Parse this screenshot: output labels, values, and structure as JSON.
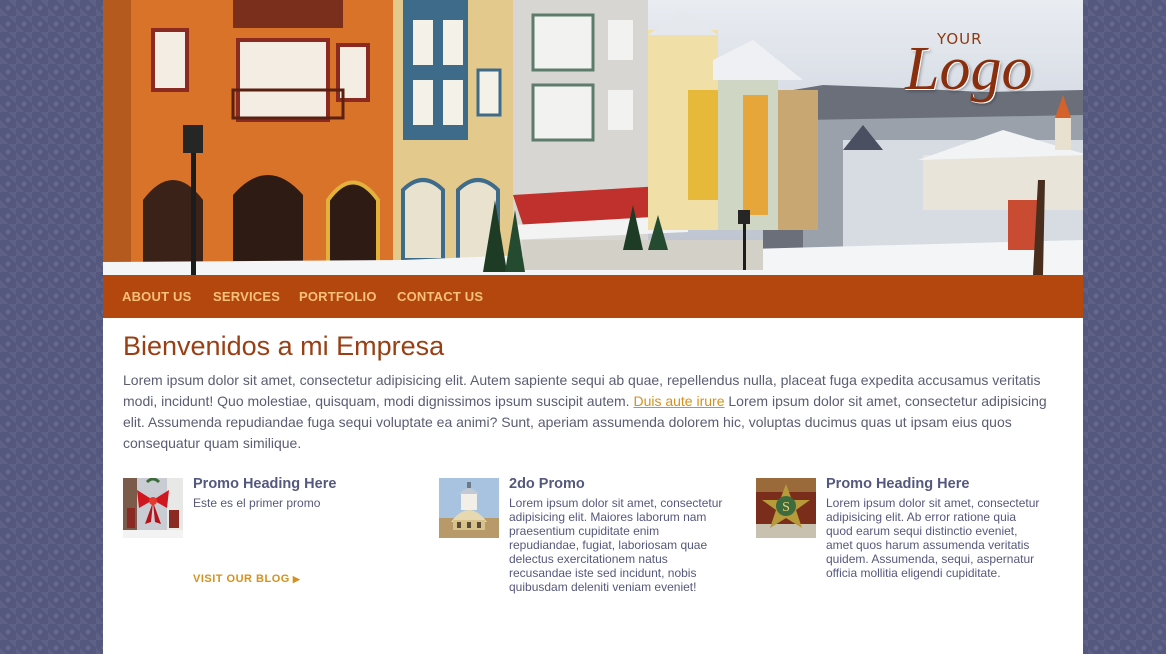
{
  "logo": {
    "small": "YOUR",
    "main": "Logo"
  },
  "nav": {
    "items": [
      {
        "label": "ABOUT US"
      },
      {
        "label": "SERVICES"
      },
      {
        "label": "PORTFOLIO"
      },
      {
        "label": "CONTACT US"
      }
    ]
  },
  "main": {
    "heading": "Bienvenidos a mi Empresa",
    "intro_before": "Lorem ipsum dolor sit amet, consectetur adipisicing elit. Autem sapiente sequi ab quae, repellendus nulla, placeat fuga expedita accusamus veritatis modi, incidunt! Quo molestiae, quisquam, modi dignissimos ipsum suscipit autem.",
    "intro_link": "Duis aute irure",
    "intro_after": "Lorem ipsum dolor sit amet, consectetur adipisicing elit. Assumenda repudiandae fuga sequi voluptate ea animi? Sunt, aperiam assumenda dolorem hic, voluptas ducimus quas ut ipsam eius quos consequatur quam similique."
  },
  "promos": [
    {
      "heading": "Promo Heading Here",
      "text": "Este es el primer promo",
      "image": "bow-ornament-thumbnail"
    },
    {
      "heading": "2do Promo",
      "text": "Lorem ipsum dolor sit amet, consectetur adipisicing elit. Maiores laborum nam praesentium cupiditate enim repudiandae, fugiat, laboriosam quae delectus exercitationem natus recusandae iste sed incidunt, nobis quibusdam deleniti veniam eveniet!",
      "image": "dome-building-thumbnail"
    },
    {
      "heading": "Promo Heading Here",
      "text": "Lorem ipsum dolor sit amet, consectetur adipisicing elit. Ab error ratione quia quod earum sequi distinctio eveniet, amet quos harum assumenda veritatis quidem. Assumenda, sequi, aspernatur officia mollitia eligendi cupiditate.",
      "image": "emblem-thumbnail"
    }
  ],
  "blog_link": {
    "label": "VISIT OUR BLOG"
  },
  "colors": {
    "nav_bg": "#b4470e",
    "nav_text": "#f6c27a",
    "heading": "#9a3f14",
    "link": "#d4911b",
    "body_bg": "#55587e"
  }
}
